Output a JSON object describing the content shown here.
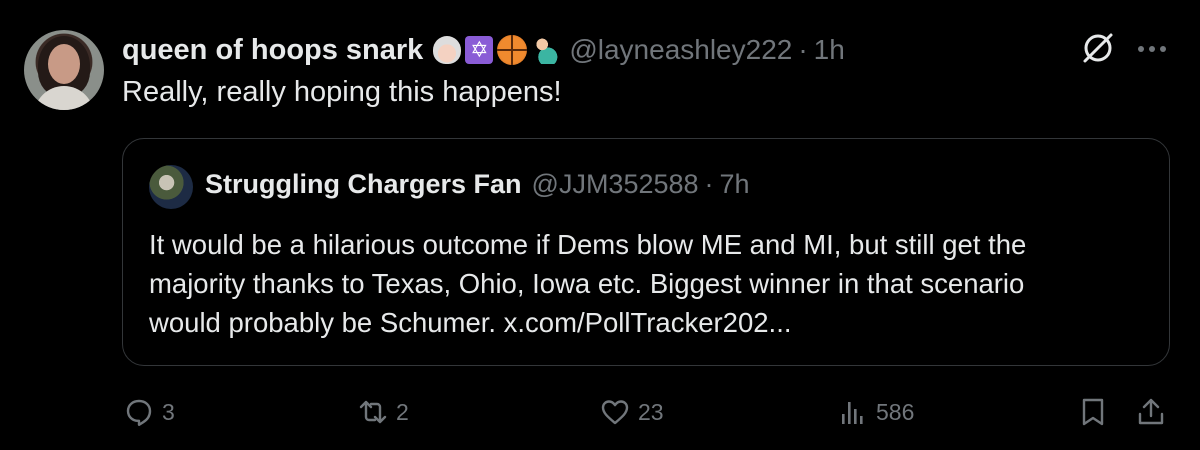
{
  "post": {
    "display_name": "queen of hoops snark",
    "emojis": [
      "princess-emoji",
      "star-of-david-emoji",
      "basketball-emoji",
      "mermaid-emoji"
    ],
    "handle": "@layneashley222",
    "separator": "·",
    "time": "1h",
    "text": "Really, really hoping this happens!"
  },
  "quote": {
    "display_name": "Struggling Chargers Fan",
    "handle": "@JJM352588",
    "separator": "·",
    "time": "7h",
    "lines": [
      "It would be a hilarious outcome if Dems blow ME and MI, but still get the",
      "majority thanks to Texas, Ohio, Iowa etc. Biggest winner in that scenario",
      "would probably be Schumer. x.com/PollTracker202..."
    ]
  },
  "actions": {
    "replies": "3",
    "reposts": "2",
    "likes": "23",
    "views": "586"
  },
  "icons": [
    "grok-icon",
    "more-icon",
    "reply-icon",
    "repost-icon",
    "like-icon",
    "views-icon",
    "bookmark-icon",
    "share-icon"
  ],
  "colors": {
    "background": "#000000",
    "text": "#e7e9ea",
    "secondary": "#71767b",
    "border": "#333639"
  }
}
